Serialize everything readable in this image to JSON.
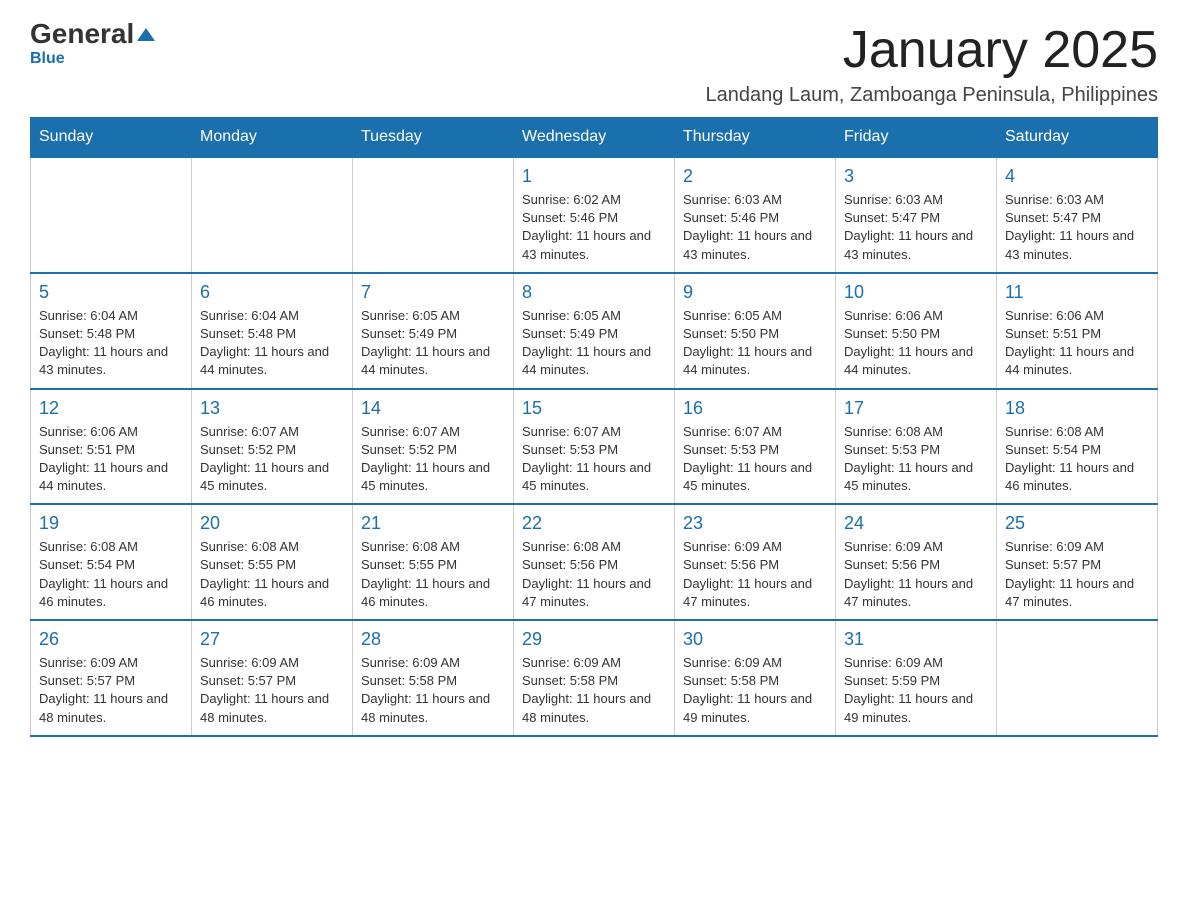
{
  "logo": {
    "brand": "General",
    "brand2": "Blue"
  },
  "header": {
    "title": "January 2025",
    "subtitle": "Landang Laum, Zamboanga Peninsula, Philippines"
  },
  "days_of_week": [
    "Sunday",
    "Monday",
    "Tuesday",
    "Wednesday",
    "Thursday",
    "Friday",
    "Saturday"
  ],
  "weeks": [
    [
      {
        "day": "",
        "info": ""
      },
      {
        "day": "",
        "info": ""
      },
      {
        "day": "",
        "info": ""
      },
      {
        "day": "1",
        "info": "Sunrise: 6:02 AM\nSunset: 5:46 PM\nDaylight: 11 hours and 43 minutes."
      },
      {
        "day": "2",
        "info": "Sunrise: 6:03 AM\nSunset: 5:46 PM\nDaylight: 11 hours and 43 minutes."
      },
      {
        "day": "3",
        "info": "Sunrise: 6:03 AM\nSunset: 5:47 PM\nDaylight: 11 hours and 43 minutes."
      },
      {
        "day": "4",
        "info": "Sunrise: 6:03 AM\nSunset: 5:47 PM\nDaylight: 11 hours and 43 minutes."
      }
    ],
    [
      {
        "day": "5",
        "info": "Sunrise: 6:04 AM\nSunset: 5:48 PM\nDaylight: 11 hours and 43 minutes."
      },
      {
        "day": "6",
        "info": "Sunrise: 6:04 AM\nSunset: 5:48 PM\nDaylight: 11 hours and 44 minutes."
      },
      {
        "day": "7",
        "info": "Sunrise: 6:05 AM\nSunset: 5:49 PM\nDaylight: 11 hours and 44 minutes."
      },
      {
        "day": "8",
        "info": "Sunrise: 6:05 AM\nSunset: 5:49 PM\nDaylight: 11 hours and 44 minutes."
      },
      {
        "day": "9",
        "info": "Sunrise: 6:05 AM\nSunset: 5:50 PM\nDaylight: 11 hours and 44 minutes."
      },
      {
        "day": "10",
        "info": "Sunrise: 6:06 AM\nSunset: 5:50 PM\nDaylight: 11 hours and 44 minutes."
      },
      {
        "day": "11",
        "info": "Sunrise: 6:06 AM\nSunset: 5:51 PM\nDaylight: 11 hours and 44 minutes."
      }
    ],
    [
      {
        "day": "12",
        "info": "Sunrise: 6:06 AM\nSunset: 5:51 PM\nDaylight: 11 hours and 44 minutes."
      },
      {
        "day": "13",
        "info": "Sunrise: 6:07 AM\nSunset: 5:52 PM\nDaylight: 11 hours and 45 minutes."
      },
      {
        "day": "14",
        "info": "Sunrise: 6:07 AM\nSunset: 5:52 PM\nDaylight: 11 hours and 45 minutes."
      },
      {
        "day": "15",
        "info": "Sunrise: 6:07 AM\nSunset: 5:53 PM\nDaylight: 11 hours and 45 minutes."
      },
      {
        "day": "16",
        "info": "Sunrise: 6:07 AM\nSunset: 5:53 PM\nDaylight: 11 hours and 45 minutes."
      },
      {
        "day": "17",
        "info": "Sunrise: 6:08 AM\nSunset: 5:53 PM\nDaylight: 11 hours and 45 minutes."
      },
      {
        "day": "18",
        "info": "Sunrise: 6:08 AM\nSunset: 5:54 PM\nDaylight: 11 hours and 46 minutes."
      }
    ],
    [
      {
        "day": "19",
        "info": "Sunrise: 6:08 AM\nSunset: 5:54 PM\nDaylight: 11 hours and 46 minutes."
      },
      {
        "day": "20",
        "info": "Sunrise: 6:08 AM\nSunset: 5:55 PM\nDaylight: 11 hours and 46 minutes."
      },
      {
        "day": "21",
        "info": "Sunrise: 6:08 AM\nSunset: 5:55 PM\nDaylight: 11 hours and 46 minutes."
      },
      {
        "day": "22",
        "info": "Sunrise: 6:08 AM\nSunset: 5:56 PM\nDaylight: 11 hours and 47 minutes."
      },
      {
        "day": "23",
        "info": "Sunrise: 6:09 AM\nSunset: 5:56 PM\nDaylight: 11 hours and 47 minutes."
      },
      {
        "day": "24",
        "info": "Sunrise: 6:09 AM\nSunset: 5:56 PM\nDaylight: 11 hours and 47 minutes."
      },
      {
        "day": "25",
        "info": "Sunrise: 6:09 AM\nSunset: 5:57 PM\nDaylight: 11 hours and 47 minutes."
      }
    ],
    [
      {
        "day": "26",
        "info": "Sunrise: 6:09 AM\nSunset: 5:57 PM\nDaylight: 11 hours and 48 minutes."
      },
      {
        "day": "27",
        "info": "Sunrise: 6:09 AM\nSunset: 5:57 PM\nDaylight: 11 hours and 48 minutes."
      },
      {
        "day": "28",
        "info": "Sunrise: 6:09 AM\nSunset: 5:58 PM\nDaylight: 11 hours and 48 minutes."
      },
      {
        "day": "29",
        "info": "Sunrise: 6:09 AM\nSunset: 5:58 PM\nDaylight: 11 hours and 48 minutes."
      },
      {
        "day": "30",
        "info": "Sunrise: 6:09 AM\nSunset: 5:58 PM\nDaylight: 11 hours and 49 minutes."
      },
      {
        "day": "31",
        "info": "Sunrise: 6:09 AM\nSunset: 5:59 PM\nDaylight: 11 hours and 49 minutes."
      },
      {
        "day": "",
        "info": ""
      }
    ]
  ]
}
